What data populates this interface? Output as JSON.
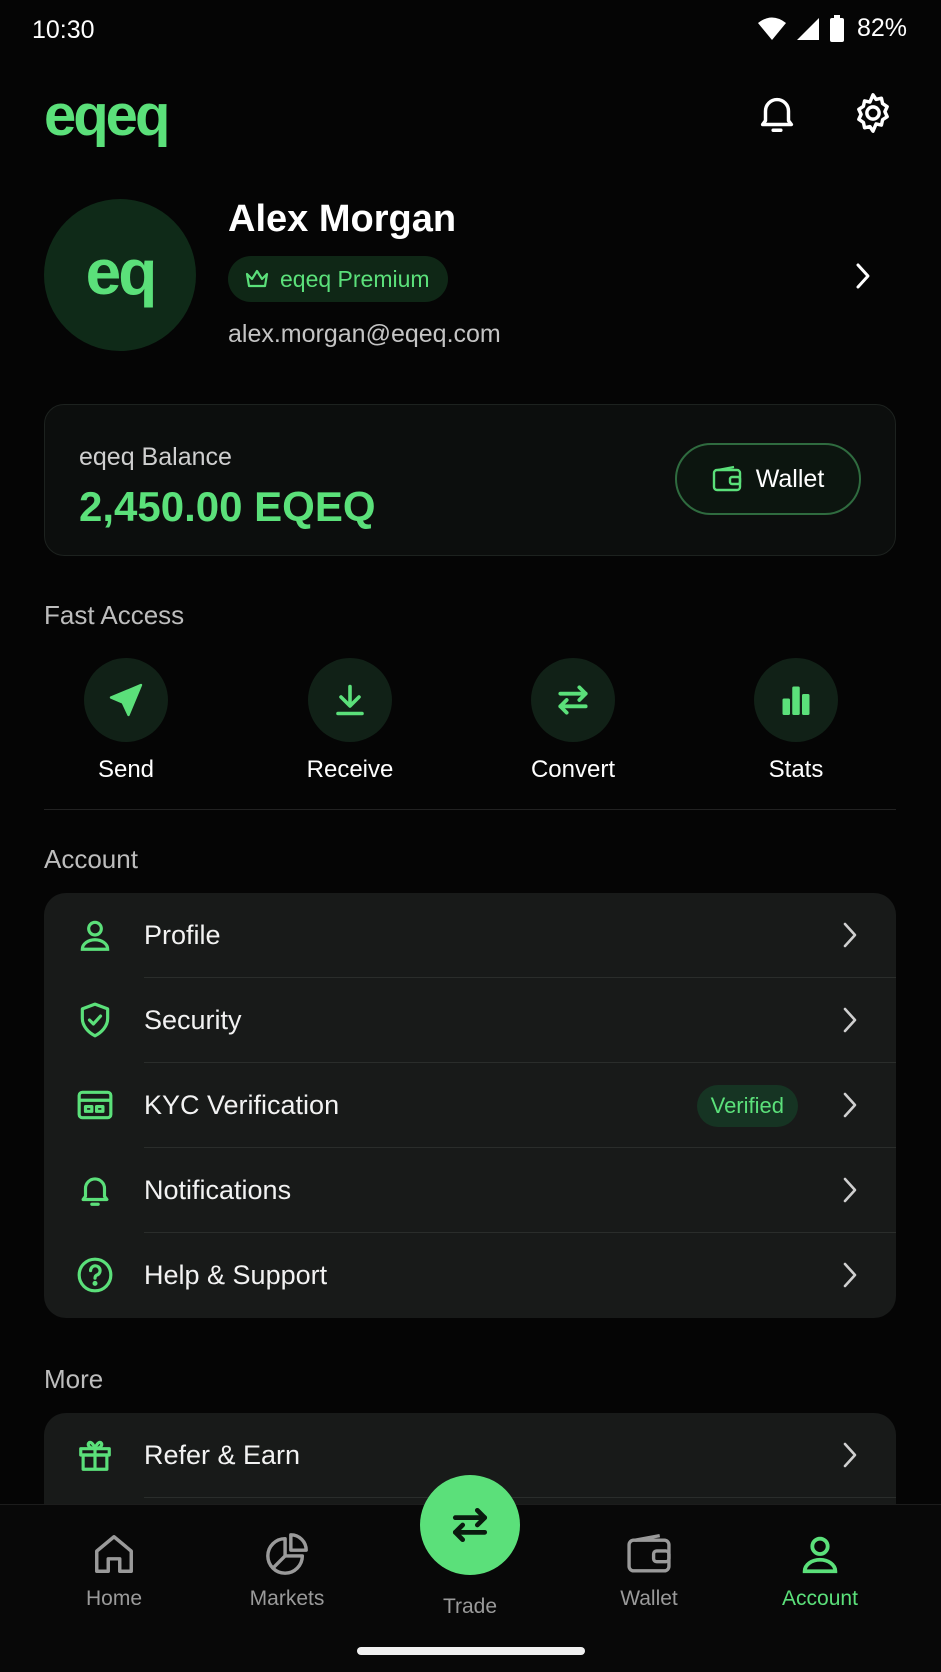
{
  "status": {
    "time": "10:30",
    "battery": "82%"
  },
  "header": {
    "logo": "eqeq"
  },
  "profile": {
    "avatar_text": "eq",
    "name": "Alex Morgan",
    "badge": "eqeq Premium",
    "email": "alex.morgan@eqeq.com"
  },
  "balance": {
    "label": "eqeq Balance",
    "value": "2,450.00 EQEQ",
    "wallet_label": "Wallet"
  },
  "fast_access": {
    "title": "Fast Access",
    "items": [
      {
        "label": "Send",
        "icon": "send-icon"
      },
      {
        "label": "Receive",
        "icon": "download-icon"
      },
      {
        "label": "Convert",
        "icon": "convert-icon"
      },
      {
        "label": "Stats",
        "icon": "bar-chart-icon"
      }
    ]
  },
  "account": {
    "title": "Account",
    "items": [
      {
        "label": "Profile",
        "icon": "user-icon"
      },
      {
        "label": "Security",
        "icon": "shield-icon"
      },
      {
        "label": "KYC Verification",
        "icon": "id-card-icon",
        "badge": "Verified"
      },
      {
        "label": "Notifications",
        "icon": "bell-icon"
      },
      {
        "label": "Help & Support",
        "icon": "help-icon"
      }
    ]
  },
  "more": {
    "title": "More",
    "items": [
      {
        "label": "Refer & Earn",
        "icon": "gift-icon"
      }
    ]
  },
  "nav": {
    "items": [
      {
        "label": "Home",
        "icon": "home-icon"
      },
      {
        "label": "Markets",
        "icon": "pie-chart-icon"
      },
      {
        "label": "Trade",
        "icon": "swap-icon"
      },
      {
        "label": "Wallet",
        "icon": "wallet-icon"
      },
      {
        "label": "Account",
        "icon": "user-icon",
        "active": true
      }
    ]
  },
  "colors": {
    "accent": "#5be07a",
    "background": "#050505",
    "card": "#181a19"
  }
}
